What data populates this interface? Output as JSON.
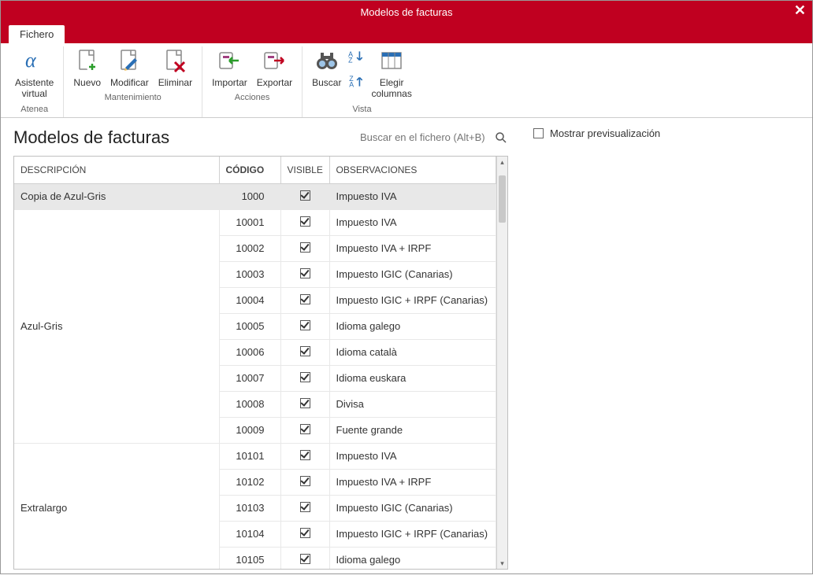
{
  "window": {
    "title": "Modelos de facturas"
  },
  "menu": {
    "file_tab": "Fichero"
  },
  "ribbon": {
    "groups": [
      {
        "label": "Atenea",
        "buttons": [
          {
            "id": "asistente",
            "label": "Asistente\nvirtual",
            "icon": "alpha-icon"
          }
        ]
      },
      {
        "label": "Mantenimiento",
        "buttons": [
          {
            "id": "nuevo",
            "label": "Nuevo",
            "icon": "page-plus-icon"
          },
          {
            "id": "modificar",
            "label": "Modificar",
            "icon": "page-pencil-icon"
          },
          {
            "id": "eliminar",
            "label": "Eliminar",
            "icon": "page-x-icon"
          }
        ]
      },
      {
        "label": "Acciones",
        "buttons": [
          {
            "id": "importar",
            "label": "Importar",
            "icon": "import-icon"
          },
          {
            "id": "exportar",
            "label": "Exportar",
            "icon": "export-icon"
          }
        ]
      },
      {
        "label": "Vista",
        "buttons": [
          {
            "id": "buscar",
            "label": "Buscar",
            "icon": "binoculars-icon"
          },
          {
            "id": "sort",
            "label": "",
            "icon": "sort-az-icon",
            "small": true
          },
          {
            "id": "columnas",
            "label": "Elegir\ncolumnas",
            "icon": "columns-icon"
          }
        ]
      }
    ]
  },
  "page": {
    "title": "Modelos de facturas",
    "search_placeholder": "Buscar en el fichero (Alt+B)"
  },
  "table": {
    "headers": {
      "descripcion": "DESCRIPCIÓN",
      "codigo": "CÓDIGO",
      "visible": "VISIBLE",
      "observaciones": "OBSERVACIONES"
    },
    "sorted_col": "codigo",
    "groups": [
      {
        "descripcion": "Copia de Azul-Gris",
        "rows": [
          {
            "codigo": "1000",
            "visible": true,
            "observaciones": "Impuesto IVA",
            "selected": true
          }
        ]
      },
      {
        "descripcion": "Azul-Gris",
        "rows": [
          {
            "codigo": "10001",
            "visible": true,
            "observaciones": "Impuesto IVA"
          },
          {
            "codigo": "10002",
            "visible": true,
            "observaciones": "Impuesto IVA + IRPF"
          },
          {
            "codigo": "10003",
            "visible": true,
            "observaciones": "Impuesto IGIC (Canarias)"
          },
          {
            "codigo": "10004",
            "visible": true,
            "observaciones": "Impuesto IGIC + IRPF (Canarias)"
          },
          {
            "codigo": "10005",
            "visible": true,
            "observaciones": "Idioma galego"
          },
          {
            "codigo": "10006",
            "visible": true,
            "observaciones": "Idioma català"
          },
          {
            "codigo": "10007",
            "visible": true,
            "observaciones": "Idioma euskara"
          },
          {
            "codigo": "10008",
            "visible": true,
            "observaciones": "Divisa"
          },
          {
            "codigo": "10009",
            "visible": true,
            "observaciones": "Fuente grande"
          }
        ]
      },
      {
        "descripcion": "Extralargo",
        "rows": [
          {
            "codigo": "10101",
            "visible": true,
            "observaciones": "Impuesto IVA"
          },
          {
            "codigo": "10102",
            "visible": true,
            "observaciones": "Impuesto IVA + IRPF"
          },
          {
            "codigo": "10103",
            "visible": true,
            "observaciones": "Impuesto IGIC (Canarias)"
          },
          {
            "codigo": "10104",
            "visible": true,
            "observaciones": "Impuesto IGIC + IRPF (Canarias)"
          },
          {
            "codigo": "10105",
            "visible": true,
            "observaciones": "Idioma galego"
          }
        ]
      }
    ]
  },
  "right": {
    "preview_label": "Mostrar previsualización",
    "preview_checked": false
  }
}
